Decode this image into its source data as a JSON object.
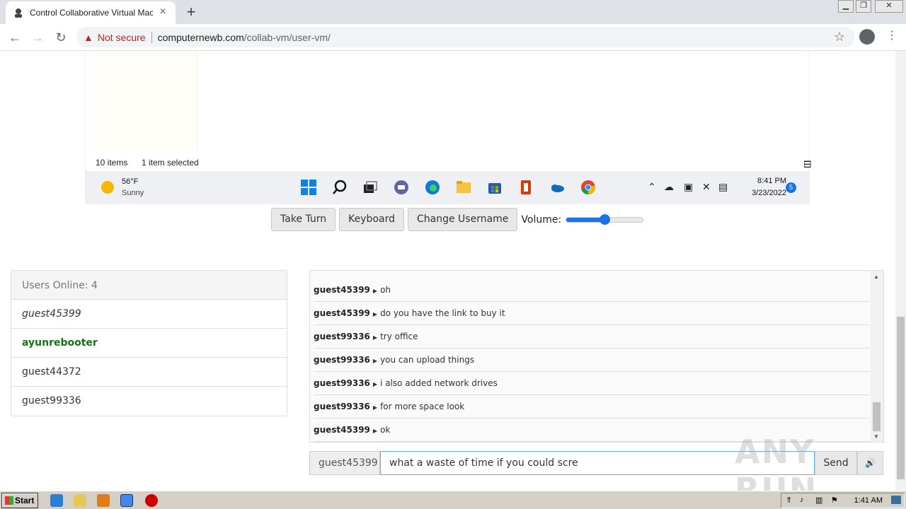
{
  "browser": {
    "tab_title": "Control Collaborative Virtual Machine",
    "new_tab": "+",
    "security_label": "Not secure",
    "url_host": "computernewb.com",
    "url_path": "/collab-vm/user-vm/",
    "window_controls": [
      "minimize",
      "restore",
      "close"
    ]
  },
  "vm": {
    "status_items": "10 items",
    "status_selected": "1 item selected",
    "weather_temp": "56°F",
    "weather_desc": "Sunny",
    "clock_time": "8:41 PM",
    "clock_date": "3/23/2022",
    "notification_count": "5",
    "taskbar_icons": [
      "windows-start-icon",
      "search-icon",
      "task-view-icon",
      "chat-icon",
      "edge-icon",
      "file-explorer-icon",
      "store-icon",
      "office-icon",
      "onedrive-icon",
      "chrome-icon"
    ]
  },
  "controls": {
    "take_turn": "Take Turn",
    "keyboard": "Keyboard",
    "change_username": "Change Username",
    "volume_label": "Volume:",
    "volume_level": 0.5
  },
  "users": {
    "header": "Users Online: 4",
    "list": [
      {
        "name": "guest45399",
        "style": "self"
      },
      {
        "name": "ayunrebooter",
        "style": "admin"
      },
      {
        "name": "guest44372",
        "style": "normal"
      },
      {
        "name": "guest99336",
        "style": "normal"
      }
    ]
  },
  "chat": {
    "messages": [
      {
        "user": "guest45399",
        "text": "oh"
      },
      {
        "user": "guest45399",
        "text": "do you have the link to buy it"
      },
      {
        "user": "guest99336",
        "text": "try office"
      },
      {
        "user": "guest99336",
        "text": "you can upload things"
      },
      {
        "user": "guest99336",
        "text": "i also added network drives"
      },
      {
        "user": "guest99336",
        "text": "for more space look"
      },
      {
        "user": "guest45399",
        "text": "ok"
      }
    ],
    "username": "guest45399",
    "input_value": "what a waste of time if you could scre",
    "send_label": "Send"
  },
  "watermark": "ANY RUN",
  "os_taskbar": {
    "start_label": "Start",
    "time": "1:41 AM"
  }
}
